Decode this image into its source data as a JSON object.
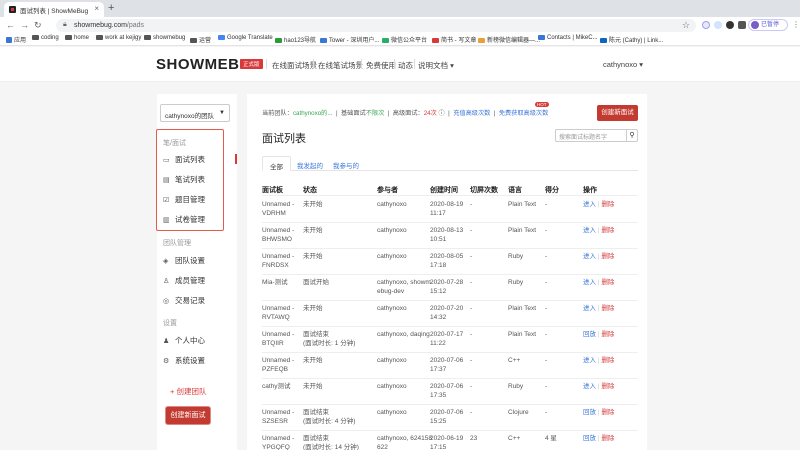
{
  "browser": {
    "tab_title": "面试列表 | ShowMeBug",
    "url_host": "showmebug.com",
    "url_path": "/pads",
    "paused_label": "已暂停"
  },
  "bookmarks": [
    "应用",
    "coding",
    "home",
    "work at kejigy",
    "showmebug",
    "运营",
    "Google Translate",
    "hao123导航",
    "Tower - 深圳用户...",
    "微信公众平台",
    "简书 - 写文章",
    "新榜微信编辑器—...",
    "Contacts | MikeC...",
    "陈元 (Cathy) | Link..."
  ],
  "header": {
    "logo_main": "SHOWMEBU",
    "logo_accent": "G",
    "edition": "正式版",
    "nav": [
      "在线面试场景",
      "在线笔试场景",
      "免费使用",
      "动态",
      "说明文档 ▾"
    ],
    "user": "cathynoxo ▾"
  },
  "sidebar": {
    "team": "cathynoxo的团队",
    "groups": {
      "written": "笔/面试",
      "team": "团队管理",
      "settings": "设置"
    },
    "items": [
      {
        "label": "面试列表",
        "icon": "monitor-icon"
      },
      {
        "label": "笔试列表",
        "icon": "doc-icon"
      },
      {
        "label": "题目管理",
        "icon": "checkbox-icon"
      },
      {
        "label": "试卷管理",
        "icon": "paper-icon"
      },
      {
        "label": "团队设置",
        "icon": "cube-icon"
      },
      {
        "label": "成员管理",
        "icon": "users-icon"
      },
      {
        "label": "交易记录",
        "icon": "coin-icon"
      },
      {
        "label": "个人中心",
        "icon": "user-icon"
      },
      {
        "label": "系统设置",
        "icon": "gear-icon"
      }
    ],
    "create_team": "+ 创建团队",
    "create_test": "创建新面试"
  },
  "main": {
    "info": {
      "team_label": "当前团队：",
      "team_name": "cathynoxo的...",
      "basic_label": "基础面试",
      "basic_value": "不限次",
      "advanced_label": "高级面试：",
      "advanced_value": "24次",
      "recharge": "充值高级次数",
      "free": "免费获取高级次数",
      "hot": "HOT"
    },
    "create_button": "创建新面试",
    "title": "面试列表",
    "search_placeholder": "搜索面试标题名字",
    "tabs": [
      "全部",
      "我发起的",
      "我参与的"
    ],
    "columns": [
      "面试板",
      "状态",
      "参与者",
      "创建时间",
      "切屏次数",
      "语言",
      "得分",
      "操作"
    ],
    "rows": [
      {
        "name1": "Unnamed -",
        "name2": "VDRHM",
        "status1": "未开始",
        "status2": "",
        "p1": "cathynoxo",
        "p2": "",
        "t1": "2020-08-19",
        "t2": "11:17",
        "switch": "-",
        "lang": "Plain Text",
        "score": "-",
        "a1": "进入",
        "a2": "删除"
      },
      {
        "name1": "Unnamed -",
        "name2": "BHWSMO",
        "status1": "未开始",
        "status2": "",
        "p1": "cathynoxo",
        "p2": "",
        "t1": "2020-08-13",
        "t2": "10:51",
        "switch": "-",
        "lang": "Plain Text",
        "score": "-",
        "a1": "进入",
        "a2": "删除"
      },
      {
        "name1": "Unnamed -",
        "name2": "FNRDSX",
        "status1": "未开始",
        "status2": "",
        "p1": "cathynoxo",
        "p2": "",
        "t1": "2020-08-05",
        "t2": "17:18",
        "switch": "-",
        "lang": "Ruby",
        "score": "-",
        "a1": "进入",
        "a2": "删除"
      },
      {
        "name1": "Mia-测试",
        "name2": "",
        "status1": "面试开始",
        "status2": "",
        "p1": "cathynoxo, showm",
        "p2": "ebug-dev",
        "t1": "2020-07-28",
        "t2": "15:12",
        "switch": "-",
        "lang": "Ruby",
        "score": "-",
        "a1": "进入",
        "a2": "删除"
      },
      {
        "name1": "Unnamed -",
        "name2": "RVTAWQ",
        "status1": "未开始",
        "status2": "",
        "p1": "cathynoxo",
        "p2": "",
        "t1": "2020-07-20",
        "t2": "14:32",
        "switch": "-",
        "lang": "Plain Text",
        "score": "-",
        "a1": "进入",
        "a2": "删除"
      },
      {
        "name1": "Unnamed -",
        "name2": "BTQIIR",
        "status1": "面试结束",
        "status2": "(面试时长: 1 分钟)",
        "p1": "cathynoxo, daqing",
        "p2": "",
        "t1": "2020-07-17",
        "t2": "11:22",
        "switch": "-",
        "lang": "Plain Text",
        "score": "-",
        "a1": "回放",
        "a2": "删除"
      },
      {
        "name1": "Unnamed -",
        "name2": "PZFEQB",
        "status1": "未开始",
        "status2": "",
        "p1": "cathynoxo",
        "p2": "",
        "t1": "2020-07-06",
        "t2": "17:37",
        "switch": "-",
        "lang": "C++",
        "score": "-",
        "a1": "进入",
        "a2": "删除"
      },
      {
        "name1": "cathy测试",
        "name2": "",
        "status1": "未开始",
        "status2": "",
        "p1": "cathynoxo",
        "p2": "",
        "t1": "2020-07-06",
        "t2": "17:35",
        "switch": "-",
        "lang": "Ruby",
        "score": "-",
        "a1": "进入",
        "a2": "删除"
      },
      {
        "name1": "Unnamed -",
        "name2": "SZSESR",
        "status1": "面试结束",
        "status2": "(面试时长: 4 分钟)",
        "p1": "cathynoxo",
        "p2": "",
        "t1": "2020-07-06",
        "t2": "15:25",
        "switch": "-",
        "lang": "Clojure",
        "score": "-",
        "a1": "回放",
        "a2": "删除"
      },
      {
        "name1": "Unnamed -",
        "name2": "YPGQFQ",
        "status1": "面试结束",
        "status2": "(面试时长: 14 分钟)",
        "p1": "cathynoxo, 624158",
        "p2": "622",
        "t1": "2020-06-19",
        "t2": "17:15",
        "switch": "23",
        "lang": "C++",
        "score": "4 星",
        "a1": "回放",
        "a2": "删除"
      }
    ]
  }
}
